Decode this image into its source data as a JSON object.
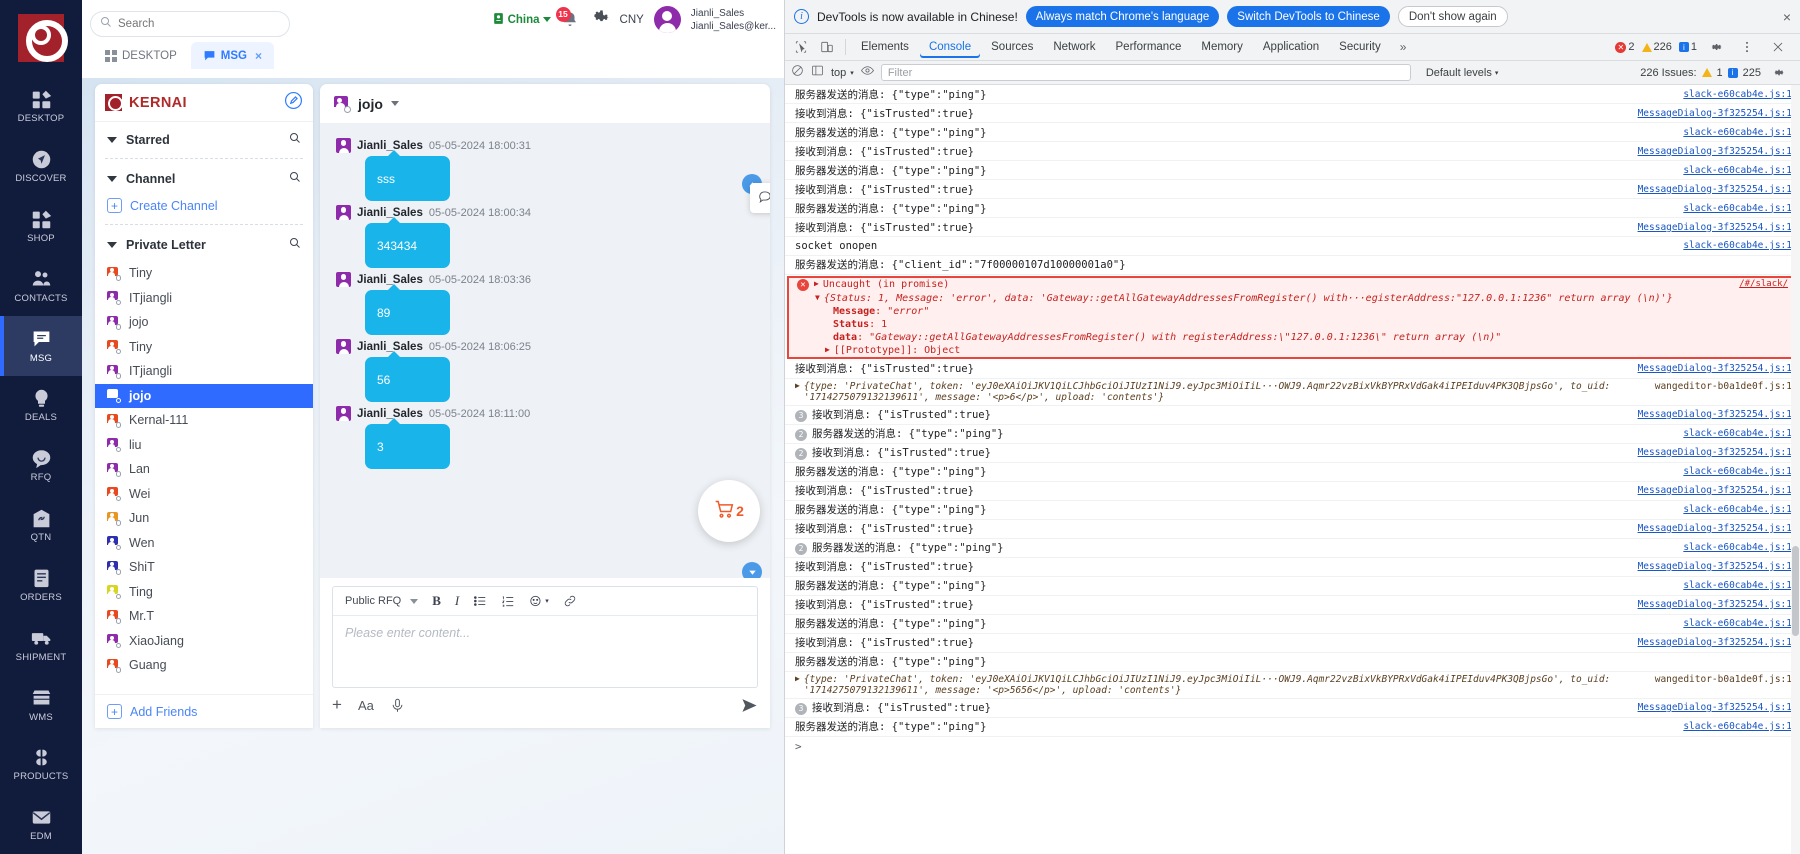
{
  "left_app": {
    "search": {
      "placeholder": "Search",
      "value": ""
    },
    "tabs": [
      {
        "label": "DESKTOP",
        "icon": "grid-icon",
        "active": false,
        "closable": false
      },
      {
        "label": "MSG",
        "icon": "chat-icon",
        "active": true,
        "closable": true,
        "close": "×"
      }
    ],
    "topright": {
      "region": "China",
      "notifications_count": "15",
      "currency": "CNY",
      "user_name": "Jianli_Sales",
      "user_email": "Jianli_Sales@ker..."
    },
    "rail": [
      {
        "label": "DESKTOP",
        "icon": "grid-icon",
        "active": false
      },
      {
        "label": "DISCOVER",
        "icon": "compass-icon",
        "active": false
      },
      {
        "label": "SHOP",
        "icon": "shop-grid-icon",
        "active": false
      },
      {
        "label": "CONTACTS",
        "icon": "contacts-icon",
        "active": false
      },
      {
        "label": "MSG",
        "icon": "message-icon",
        "active": true
      },
      {
        "label": "DEALS",
        "icon": "bulb-icon",
        "active": false
      },
      {
        "label": "RFQ",
        "icon": "chat-bubble-icon",
        "active": false
      },
      {
        "label": "QTN",
        "icon": "tag-icon",
        "active": false
      },
      {
        "label": "ORDERS",
        "icon": "clipboard-icon",
        "active": false
      },
      {
        "label": "SHIPMENT",
        "icon": "truck-icon",
        "active": false
      },
      {
        "label": "WMS",
        "icon": "warehouse-icon",
        "active": false
      },
      {
        "label": "PRODUCTS",
        "icon": "clover-icon",
        "active": false
      },
      {
        "label": "EDM",
        "icon": "envelope-icon",
        "active": false
      }
    ],
    "contacts": {
      "brand": "KERNAI",
      "compose_icon": "pencil-circle-icon",
      "sections": [
        {
          "title": "Starred",
          "search_icon": "search-icon"
        },
        {
          "title": "Channel",
          "search_icon": "search-icon",
          "action_label": "Create Channel"
        },
        {
          "title": "Private Letter",
          "search_icon": "search-icon"
        }
      ],
      "people": [
        {
          "name": "Tiny",
          "color": "#e8491f",
          "selected": false
        },
        {
          "name": "ITjiangli",
          "color": "#8e2bab",
          "selected": false
        },
        {
          "name": "jojo",
          "color": "#8e2bab",
          "selected": false
        },
        {
          "name": "Tiny",
          "color": "#e8491f",
          "selected": false
        },
        {
          "name": "ITjiangli",
          "color": "#8e2bab",
          "selected": false
        },
        {
          "name": "jojo",
          "color": "#ffffff",
          "selected": true
        },
        {
          "name": "Kernal-111",
          "color": "#e8491f",
          "selected": false
        },
        {
          "name": "liu",
          "color": "#8e2bab",
          "selected": false
        },
        {
          "name": "Lan",
          "color": "#8e2bab",
          "selected": false
        },
        {
          "name": "Wei",
          "color": "#e8491f",
          "selected": false
        },
        {
          "name": "Jun",
          "color": "#e8961f",
          "selected": false
        },
        {
          "name": "Wen",
          "color": "#2d2fb0",
          "selected": false
        },
        {
          "name": "ShiT",
          "color": "#2d2fb0",
          "selected": false
        },
        {
          "name": "Ting",
          "color": "#d6d622",
          "selected": false
        },
        {
          "name": "Mr.T",
          "color": "#e8491f",
          "selected": false
        },
        {
          "name": "XiaoJiang",
          "color": "#8e2bab",
          "selected": false
        },
        {
          "name": "Guang",
          "color": "#e8491f",
          "selected": false
        }
      ],
      "add_friends": "Add Friends"
    },
    "chat": {
      "title": "jojo",
      "hover_actions": [
        "reply-icon",
        "delete-icon",
        "forward-icon"
      ],
      "messages": [
        {
          "sender": "Jianli_Sales",
          "time": "05-05-2024 18:00:31",
          "text": "sss"
        },
        {
          "sender": "Jianli_Sales",
          "time": "05-05-2024 18:00:34",
          "text": "343434"
        },
        {
          "sender": "Jianli_Sales",
          "time": "05-05-2024 18:03:36",
          "text": "89"
        },
        {
          "sender": "Jianli_Sales",
          "time": "05-05-2024 18:06:25",
          "text": "56"
        },
        {
          "sender": "Jianli_Sales",
          "time": "05-05-2024 18:11:00",
          "text": "3"
        }
      ],
      "cart_count": "2",
      "composer": {
        "type_label": "Public RFQ",
        "tools": [
          "bold",
          "italic",
          "bullet-list",
          "numbered-list",
          "emoji",
          "link"
        ],
        "placeholder": "Please enter content...",
        "bold_label": "B",
        "italic_label": "I",
        "footer_tools": [
          "plus",
          "font-size",
          "microphone",
          "send"
        ],
        "font_label": "Aa",
        "plus_label": "+"
      }
    }
  },
  "devtools": {
    "banner": {
      "message": "DevTools is now available in Chinese!",
      "primary_button": "Always match Chrome's language",
      "secondary_button": "Switch DevTools to Chinese",
      "tertiary_button": "Don't show again",
      "close": "×"
    },
    "tabs": [
      {
        "label": "Elements",
        "active": false
      },
      {
        "label": "Console",
        "active": true
      },
      {
        "label": "Sources",
        "active": false
      },
      {
        "label": "Network",
        "active": false
      },
      {
        "label": "Performance",
        "active": false
      },
      {
        "label": "Memory",
        "active": false
      },
      {
        "label": "Application",
        "active": false
      },
      {
        "label": "Security",
        "active": false
      }
    ],
    "more_tabs": "»",
    "counters": {
      "errors": "2",
      "warnings": "226",
      "info": "1"
    },
    "settings_icon": "gear-icon",
    "menu_icon": "kebab-icon",
    "close_icon": "close-icon",
    "filterbar": {
      "clear_icon": "no-entry-icon",
      "context": "top",
      "eye_icon": "eye-icon",
      "filter_placeholder": "Filter",
      "levels": "Default levels",
      "issues": "226 Issues:",
      "issue_warnings": "1",
      "issue_info": "225"
    },
    "console_rows": [
      {
        "text": "服务器发送的消息: {\"type\":\"ping\"}",
        "src": "slack-e60cab4e.js:1",
        "badge": ""
      },
      {
        "text": "接收到消息: {\"isTrusted\":true}",
        "src": "MessageDialog-3f325254.js:1",
        "badge": ""
      },
      {
        "text": "服务器发送的消息: {\"type\":\"ping\"}",
        "src": "slack-e60cab4e.js:1",
        "badge": ""
      },
      {
        "text": "接收到消息: {\"isTrusted\":true}",
        "src": "MessageDialog-3f325254.js:1",
        "badge": ""
      },
      {
        "text": "服务器发送的消息: {\"type\":\"ping\"}",
        "src": "slack-e60cab4e.js:1",
        "badge": ""
      },
      {
        "text": "接收到消息: {\"isTrusted\":true}",
        "src": "MessageDialog-3f325254.js:1",
        "badge": ""
      },
      {
        "text": "服务器发送的消息: {\"type\":\"ping\"}",
        "src": "slack-e60cab4e.js:1",
        "badge": ""
      },
      {
        "text": "接收到消息: {\"isTrusted\":true}",
        "src": "MessageDialog-3f325254.js:1",
        "badge": ""
      },
      {
        "text": "socket onopen",
        "src": "slack-e60cab4e.js:1",
        "badge": ""
      },
      {
        "text": "服务器发送的消息: {\"client_id\":\"7f00000107d10000001a0\"}",
        "src": "",
        "badge": ""
      }
    ],
    "error_block": {
      "source": "/#/slack/",
      "line1": "Uncaught (in promise)",
      "line2": "{Status: 1, Message: 'error', data: 'Gateway::getAllGatewayAddressesFromRegister() with···egisterAddress:\"127.0.0.1:1236\" return array (\\n)'}",
      "line3_key": "Message",
      "line3_val": "\"error\"",
      "line4_key": "Status",
      "line4_val": "1",
      "line5_key": "data",
      "line5_val": "\"Gateway::getAllGatewayAddressesFromRegister() with registerAddress:\\\"127.0.0.1:1236\\\" return array (\\n)\"",
      "line6": "[[Prototype]]: Object"
    },
    "console_rows_2": [
      {
        "text": "接收到消息: {\"isTrusted\":true}",
        "src": "MessageDialog-3f325254.js:1",
        "badge": ""
      }
    ],
    "obj_row_1": {
      "src": "wangeditor-b0a1de0f.js:1",
      "text": "{type: 'PrivateChat', token: 'eyJ0eXAiOiJKV1QiLCJhbGciOiJIUzI1NiJ9.eyJpc3MiOiIiL···OWJ9.Aqmr22vzBixVkBYPRxVdGak4iIPEIduv4PK3QBjpsGo', to_uid: '1714275079132139611', message: '<p>6</p>', upload: 'contents'}"
    },
    "console_rows_3": [
      {
        "text": "接收到消息: {\"isTrusted\":true}",
        "src": "MessageDialog-3f325254.js:1",
        "badge": "3"
      },
      {
        "text": "服务器发送的消息: {\"type\":\"ping\"}",
        "src": "slack-e60cab4e.js:1",
        "badge": "2"
      },
      {
        "text": "接收到消息: {\"isTrusted\":true}",
        "src": "MessageDialog-3f325254.js:1",
        "badge": "2"
      },
      {
        "text": "服务器发送的消息: {\"type\":\"ping\"}",
        "src": "slack-e60cab4e.js:1",
        "badge": ""
      },
      {
        "text": "接收到消息: {\"isTrusted\":true}",
        "src": "MessageDialog-3f325254.js:1",
        "badge": ""
      },
      {
        "text": "服务器发送的消息: {\"type\":\"ping\"}",
        "src": "slack-e60cab4e.js:1",
        "badge": ""
      },
      {
        "text": "接收到消息: {\"isTrusted\":true}",
        "src": "MessageDialog-3f325254.js:1",
        "badge": ""
      },
      {
        "text": "服务器发送的消息: {\"type\":\"ping\"}",
        "src": "slack-e60cab4e.js:1",
        "badge": "2"
      },
      {
        "text": "接收到消息: {\"isTrusted\":true}",
        "src": "MessageDialog-3f325254.js:1",
        "badge": ""
      },
      {
        "text": "服务器发送的消息: {\"type\":\"ping\"}",
        "src": "slack-e60cab4e.js:1",
        "badge": ""
      },
      {
        "text": "接收到消息: {\"isTrusted\":true}",
        "src": "MessageDialog-3f325254.js:1",
        "badge": ""
      },
      {
        "text": "服务器发送的消息: {\"type\":\"ping\"}",
        "src": "slack-e60cab4e.js:1",
        "badge": ""
      },
      {
        "text": "接收到消息: {\"isTrusted\":true}",
        "src": "MessageDialog-3f325254.js:1",
        "badge": ""
      },
      {
        "text": "服务器发送的消息: {\"type\":\"ping\"}",
        "src": "",
        "badge": ""
      }
    ],
    "obj_row_2": {
      "src": "wangeditor-b0a1de0f.js:1",
      "text": "{type: 'PrivateChat', token: 'eyJ0eXAiOiJKV1QiLCJhbGciOiJIUzI1NiJ9.eyJpc3MiOiIiL···OWJ9.Aqmr22vzBixVkBYPRxVdGak4iIPEIduv4PK3QBjpsGo', to_uid: '1714275079132139611', message: '<p>5656</p>', upload: 'contents'}"
    },
    "console_rows_4": [
      {
        "text": "接收到消息: {\"isTrusted\":true}",
        "src": "MessageDialog-3f325254.js:1",
        "badge": "3"
      },
      {
        "text": "服务器发送的消息: {\"type\":\"ping\"}",
        "src": "slack-e60cab4e.js:1",
        "badge": ""
      }
    ],
    "prompt": ">"
  }
}
